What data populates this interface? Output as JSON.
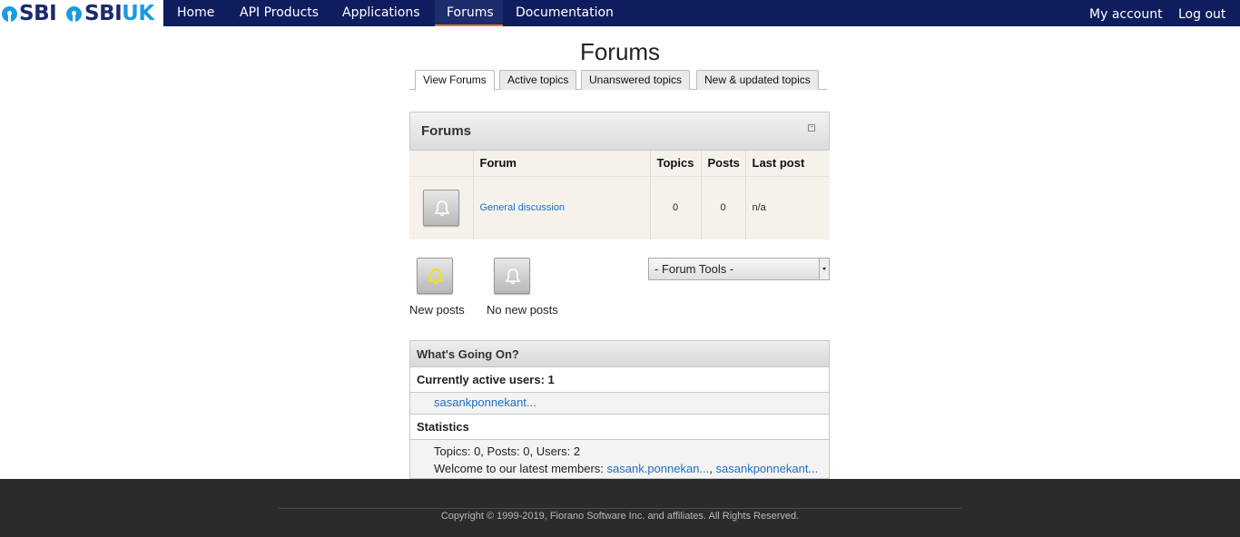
{
  "brand": {
    "logo_text_1": "SBI",
    "logo_text_2": "SBI",
    "logo_text_uk": "UK"
  },
  "nav": {
    "items": [
      {
        "label": "Home"
      },
      {
        "label": "API Products"
      },
      {
        "label": "Applications"
      },
      {
        "label": "Forums",
        "active": true
      },
      {
        "label": "Documentation"
      }
    ],
    "account": "My account",
    "logout": "Log out"
  },
  "page": {
    "title": "Forums"
  },
  "tabs": [
    {
      "label": "View Forums",
      "active": true
    },
    {
      "label": "Active topics"
    },
    {
      "label": "Unanswered topics"
    },
    {
      "label": "New & updated topics"
    }
  ],
  "forum_panel": {
    "title": "Forums",
    "columns": [
      "Forum",
      "Topics",
      "Posts",
      "Last post"
    ],
    "rows": [
      {
        "forum": "General discussion",
        "topics": "0",
        "posts": "0",
        "last_post": "n/a"
      }
    ]
  },
  "legend": {
    "new_posts": "New posts",
    "no_new_posts": "No new posts"
  },
  "forum_tools": {
    "selected": "- Forum Tools -"
  },
  "whats_going_on": {
    "title": "What's Going On?",
    "active_users_heading": "Currently active users: 1",
    "active_users": [
      "sasankponnekant..."
    ],
    "statistics_heading": "Statistics",
    "stats_line": "Topics: 0, Posts: 0, Users: 2",
    "latest_prefix": "Welcome to our latest members:",
    "latest_members": [
      "sasank.ponnekan...",
      "sasankponnekant..."
    ],
    "separator": ","
  },
  "footer": {
    "copyright": "Copyright © 1999-2019, Fiorano Software Inc. and affiliates. All Rights Reserved."
  },
  "colors": {
    "nav_bg": "#0f1d5e",
    "accent": "#e07b22",
    "link": "#1f6fc4",
    "footer_bg": "#2b2b2b"
  }
}
